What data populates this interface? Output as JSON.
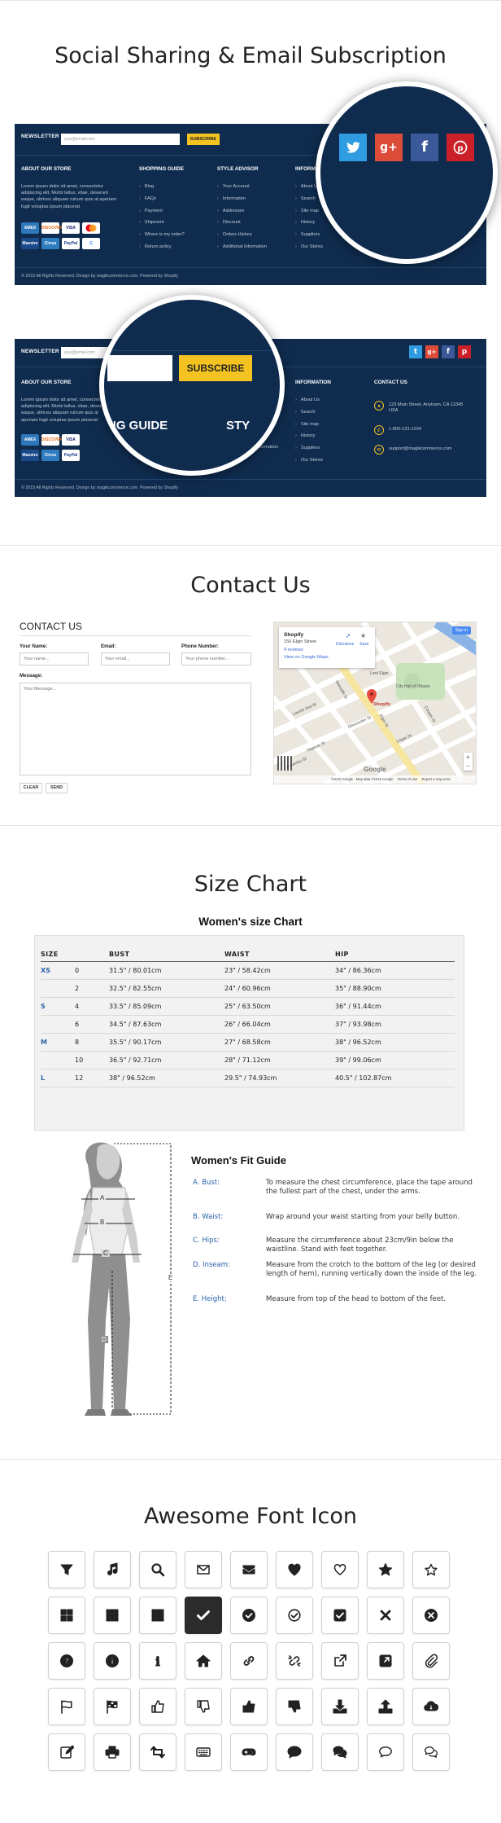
{
  "sections": {
    "social": "Social Sharing & Email Subscription",
    "contact": "Contact Us",
    "size": "Size Chart",
    "icons": "Awesome Font Icon"
  },
  "footer": {
    "newsletter_label": "NEWSLETTER",
    "email_placeholder": "your@email.com",
    "subscribe_label": "SUBSCRIBE",
    "about_title": "ABOUT OUR STORE",
    "about_text": "Lorem ipsum dolor sit amet, consectetur adipiscing elit. Morbi tellus, vitae, deserunt eaque, ultrices aliquam rutrum quis at aperiam fugit voluptas ipsum placerat",
    "shopping_title": "SHOPPING GUIDE",
    "shopping_items": [
      "Blog",
      "FAQs",
      "Payment",
      "Shipment",
      "Where is my order?",
      "Return policy"
    ],
    "style_title": "STYLE ADVISOR",
    "style_items": [
      "Your Account",
      "Information",
      "Addresses",
      "Discount",
      "Orders History",
      "Additional Information"
    ],
    "info_title": "INFORMATION",
    "info_items": [
      "About Us",
      "Search",
      "Site map",
      "History",
      "Suppliers",
      "Our Stores"
    ],
    "contact_title": "CONTACT US",
    "contact_address": "123 Main Street, Anytown, CA 12345 USA",
    "contact_phone": "1-800-123-1234",
    "contact_email": "support@magikcommerce.com",
    "copyright": "© 2015 All Rights Reserved. Design by magikcommerce.com. Powered by Shopify",
    "payments": [
      "AMEX",
      "DISCOVER",
      "VISA",
      "MC",
      "Maestro",
      "Cirrus",
      "PayPal",
      "G"
    ],
    "zoom_shopping": "NG GUIDE",
    "zoom_style": "STY",
    "info_title_short": "INFORM",
    "social_colors": {
      "twitter": "#2f9be0",
      "gplus": "#dd4b39",
      "facebook": "#3b5998",
      "pinterest": "#cb2027"
    }
  },
  "contact_form": {
    "title": "CONTACT US",
    "name_label": "Your Name:",
    "name_placeholder": "Your name...",
    "email_label": "Email:",
    "email_placeholder": "Your email...",
    "phone_label": "Phone Number:",
    "phone_placeholder": "Your phone number...",
    "message_label": "Message:",
    "message_placeholder": "Your Message...",
    "clear_label": "CLEAR",
    "send_label": "SEND"
  },
  "map": {
    "place_name": "Shopify",
    "place_address": "150 Elgin Street",
    "reviews": "4 reviews",
    "view_link": "View on Google Maps",
    "directions": "Directions",
    "save": "Save",
    "sign_in": "Sign in",
    "marker_label": "Shopify",
    "city_hall": "City Hall of Ottawa",
    "lord_elgin": "Lord Elgin",
    "streets": [
      "Laurier Ave W",
      "Gloucester St",
      "Nepean St",
      "Lisgar St",
      "Elgin St",
      "Metcalfe St",
      "Cooper St",
      "Waverley St"
    ],
    "footer_text": "©2015 Google · Map data ©2015 Google",
    "terms": "Terms of Use",
    "report": "Report a map error",
    "logo": "Google"
  },
  "size_chart": {
    "subtitle": "Women's size Chart",
    "headers": [
      "SIZE",
      "",
      "BUST",
      "WAIST",
      "HIP"
    ],
    "rows": [
      [
        "XS",
        "0",
        "31.5\" / 80.01cm",
        "23\" / 58.42cm",
        "34\" / 86.36cm"
      ],
      [
        "",
        "2",
        "32.5\" / 82.55cm",
        "24\" / 60.96cm",
        "35\" / 88.90cm"
      ],
      [
        "S",
        "4",
        "33.5\" / 85.09cm",
        "25\" / 63.50cm",
        "36\" / 91.44cm"
      ],
      [
        "",
        "6",
        "34.5\" / 87.63cm",
        "26\" / 66.04cm",
        "37\" / 93.98cm"
      ],
      [
        "M",
        "8",
        "35.5\" / 90.17cm",
        "27\" / 68.58cm",
        "38\" / 96.52cm"
      ],
      [
        "",
        "10",
        "36.5\" / 92.71cm",
        "28\" / 71.12cm",
        "39\" / 99.06cm"
      ],
      [
        "L",
        "12",
        "38\" / 96.52cm",
        "29.5\" / 74.93cm",
        "40.5\" / 102.87cm"
      ]
    ],
    "figure_markers": [
      "A",
      "B",
      "C",
      "D",
      "E"
    ]
  },
  "fit_guide": {
    "title": "Women's Fit Guide",
    "items": [
      {
        "key": "A. Bust:",
        "text": "To measure the chest circumference, place the tape around the fullest part of the chest, under the arms."
      },
      {
        "key": "B. Waist:",
        "text": "Wrap around your waist starting from your belly button."
      },
      {
        "key": "C. Hips:",
        "text": "Measure the circumference about 23cm/9in below the waistline. Stand with feet together."
      },
      {
        "key": "D. Inseam:",
        "text": "Measure from the crotch to the bottom of the leg (or desired length of hem), running vertically down the inside of the leg."
      },
      {
        "key": "E. Height:",
        "text": "Measure from top of the head to bottom of the feet."
      }
    ]
  },
  "icons": [
    "filter-icon",
    "music-icon",
    "search-icon",
    "envelope-o-icon",
    "envelope-icon",
    "heart-icon",
    "heart-o-icon",
    "star-icon",
    "star-o-icon",
    "th-large-icon",
    "th-icon",
    "th-list-icon",
    "check-icon",
    "check-circle-icon",
    "check-circle-o-icon",
    "check-square-icon",
    "times-icon",
    "times-circle-icon",
    "question-circle-icon",
    "info-circle-icon",
    "info-icon",
    "home-icon",
    "link-icon",
    "unlink-icon",
    "external-link-icon",
    "external-link-square-icon",
    "paperclip-icon",
    "flag-o-icon",
    "flag-checkered-icon",
    "thumbs-o-up-icon",
    "thumbs-o-down-icon",
    "thumbs-up-icon",
    "thumbs-down-icon",
    "download-icon",
    "upload-icon",
    "cloud-download-icon",
    "edit-icon",
    "print-icon",
    "retweet-icon",
    "keyboard-icon",
    "gamepad-icon",
    "comment-icon",
    "comments-icon",
    "comment-o-icon",
    "comments-o-icon"
  ],
  "active_icon": "check-icon"
}
